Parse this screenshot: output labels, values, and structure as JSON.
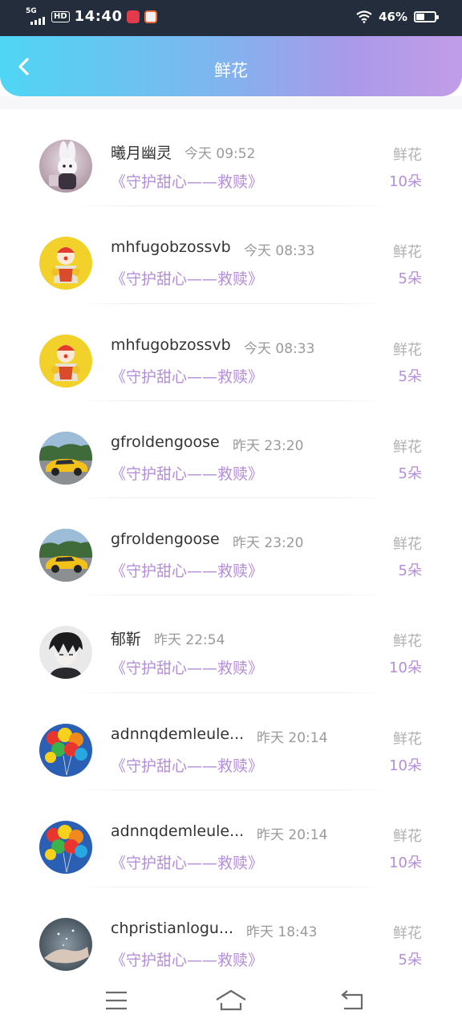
{
  "status_bar": {
    "network": "5G",
    "hd": "HD",
    "time": "14:40",
    "battery_percent_text": "46%",
    "battery_level": 0.46
  },
  "header": {
    "title": "鲜花",
    "back_icon": "chevron-left-icon"
  },
  "records": [
    {
      "name": "曦月幽灵",
      "time": "今天 09:52",
      "gift": "《守护甜心——救赎》",
      "type": "鲜花",
      "count": "10朵",
      "avatar": "rabbit-avatar"
    },
    {
      "name": "mhfugobzossvb",
      "time": "今天 08:33",
      "gift": "《守护甜心——救赎》",
      "type": "鲜花",
      "count": "5朵",
      "avatar": "clown-avatar"
    },
    {
      "name": "mhfugobzossvb",
      "time": "今天 08:33",
      "gift": "《守护甜心——救赎》",
      "type": "鲜花",
      "count": "5朵",
      "avatar": "clown-avatar"
    },
    {
      "name": "gfroldengoose",
      "time": "昨天 23:20",
      "gift": "《守护甜心——救赎》",
      "type": "鲜花",
      "count": "5朵",
      "avatar": "car-avatar"
    },
    {
      "name": "gfroldengoose",
      "time": "昨天 23:20",
      "gift": "《守护甜心——救赎》",
      "type": "鲜花",
      "count": "5朵",
      "avatar": "car-avatar"
    },
    {
      "name": "郁靳",
      "time": "昨天 22:54",
      "gift": "《守护甜心——救赎》",
      "type": "鲜花",
      "count": "10朵",
      "avatar": "anime-avatar"
    },
    {
      "name": "adnnqdemleule...",
      "time": "昨天 20:14",
      "gift": "《守护甜心——救赎》",
      "type": "鲜花",
      "count": "10朵",
      "avatar": "balloons-avatar"
    },
    {
      "name": "adnnqdemleule...",
      "time": "昨天 20:14",
      "gift": "《守护甜心——救赎》",
      "type": "鲜花",
      "count": "10朵",
      "avatar": "balloons-avatar"
    },
    {
      "name": "chpristianlogu...",
      "time": "昨天 18:43",
      "gift": "《守护甜心——救赎》",
      "type": "鲜花",
      "count": "5朵",
      "avatar": "hands-avatar"
    }
  ],
  "nav_bar": {
    "menu_icon": "menu-icon",
    "home_icon": "home-icon",
    "back_icon": "back-icon"
  },
  "colors": {
    "accent": "#b48ed8",
    "status_bar": "#242d3b",
    "header_start": "#4fd6f4",
    "header_end": "#c19de8"
  }
}
